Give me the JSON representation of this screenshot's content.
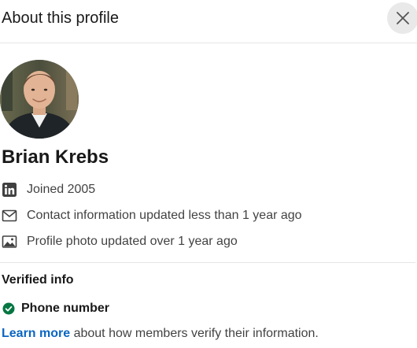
{
  "dialog": {
    "title": "About this profile",
    "close_icon": "close-icon"
  },
  "profile": {
    "name": "Brian Krebs",
    "avatar_icon": "profile-photo"
  },
  "details": [
    {
      "icon": "linkedin-icon",
      "text": "Joined 2005"
    },
    {
      "icon": "envelope-icon",
      "text": "Contact information updated less than 1 year ago"
    },
    {
      "icon": "image-icon",
      "text": "Profile photo updated over 1 year ago"
    }
  ],
  "verified": {
    "heading": "Verified info",
    "items": [
      {
        "icon": "check-circle-icon",
        "label": "Phone number",
        "color": "#057642"
      }
    ]
  },
  "footer": {
    "link_label": "Learn more",
    "rest_text": " about how members verify their information."
  },
  "colors": {
    "link": "#0a66c2",
    "verified_check": "#057642"
  }
}
